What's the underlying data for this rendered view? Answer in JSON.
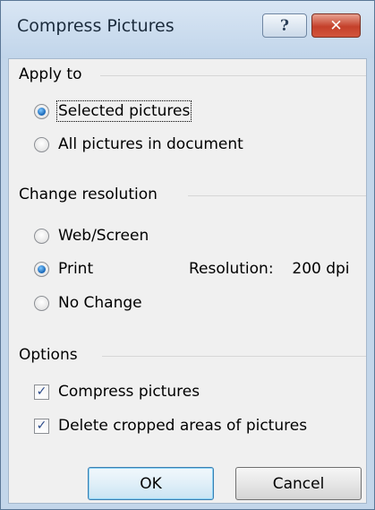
{
  "window": {
    "title": "Compress Pictures",
    "help_icon": "help-icon",
    "close_icon": "close-icon"
  },
  "apply_to": {
    "heading": "Apply to",
    "options": [
      {
        "label": "Selected pictures",
        "selected": true
      },
      {
        "label": "All pictures in document",
        "selected": false
      }
    ]
  },
  "change_resolution": {
    "heading": "Change resolution",
    "options": [
      {
        "label": "Web/Screen",
        "selected": false
      },
      {
        "label": "Print",
        "selected": true
      },
      {
        "label": "No Change",
        "selected": false
      }
    ],
    "resolution_label": "Resolution:",
    "resolution_value": "200 dpi"
  },
  "options": {
    "heading": "Options",
    "checkboxes": [
      {
        "label": "Compress pictures",
        "checked": true
      },
      {
        "label": "Delete cropped areas of pictures",
        "checked": true
      }
    ]
  },
  "buttons": {
    "ok": "OK",
    "cancel": "Cancel"
  },
  "colors": {
    "titlebar": "#c3d6ea",
    "close_button": "#c4402a",
    "dialog_background": "#f0f0f0"
  }
}
